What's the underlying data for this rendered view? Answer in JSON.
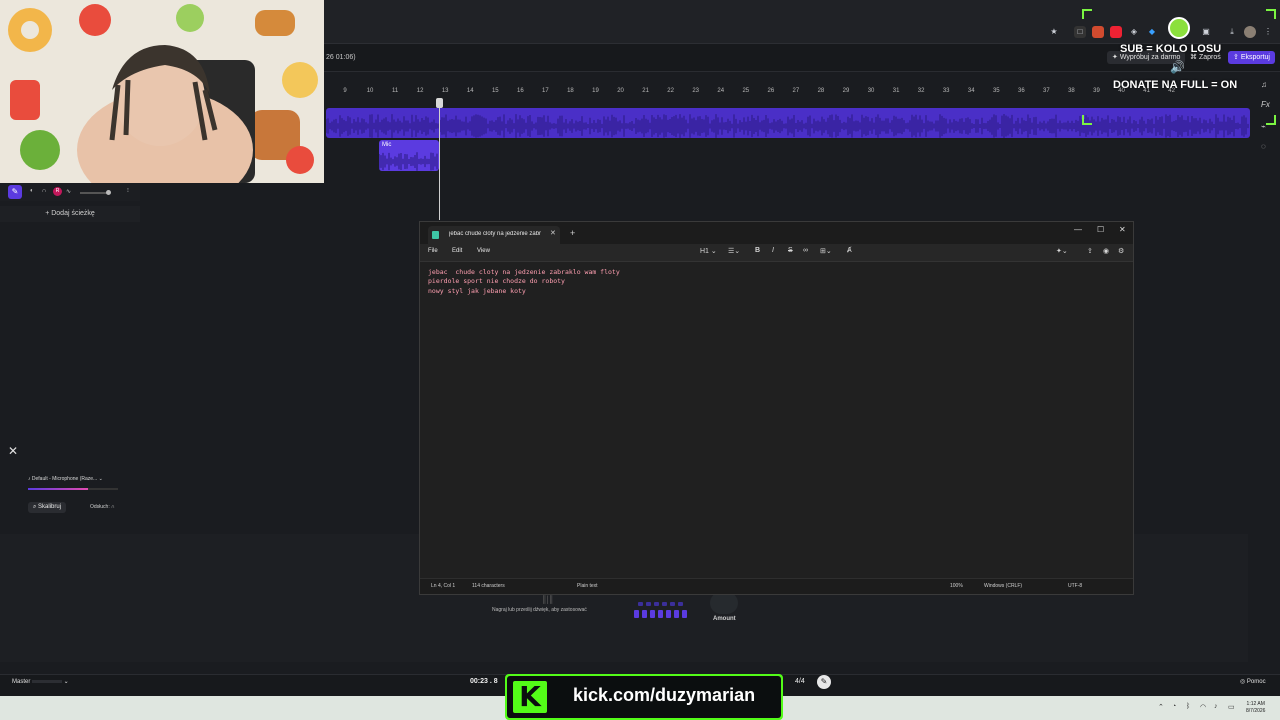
{
  "app": {
    "header_time": "26 01:06)",
    "try_free": "Wypróbuj za darmo",
    "invite": "Zaproś",
    "export": "Eksportuj"
  },
  "timeline": {
    "ticks": [
      "9",
      "10",
      "11",
      "12",
      "13",
      "14",
      "15",
      "16",
      "17",
      "18",
      "19",
      "20",
      "21",
      "22",
      "23",
      "24",
      "25",
      "26",
      "27",
      "28",
      "29",
      "30",
      "31",
      "32",
      "33",
      "34",
      "35",
      "36",
      "37",
      "38",
      "39",
      "40",
      "41",
      "42"
    ],
    "mic_clip_label": "Mic"
  },
  "left_panel": {
    "record_badge": "R",
    "add_track": "Dodaj ścieżkę"
  },
  "bottom_panel": {
    "mic_device": "Default - Microphone (Raze...",
    "calibrate": "Skalibruj",
    "monitor": "Odsłuch:",
    "record_hint": "Nagraj lub prześlij dźwięk, aby zastosować",
    "amount": "Amount"
  },
  "footer": {
    "master": "Master",
    "time": "00:23 . 8",
    "pages": "4/4",
    "help": "Pomoc"
  },
  "taskbar": {
    "time": "1:12 AM",
    "date": "8/7/2026"
  },
  "overlays": {
    "sub": "SUB = KOLO LOSU",
    "donate": "DONATE NA FULL = ON",
    "kick_url": "kick.com/duzymarian",
    "kick_logo": "K"
  },
  "notepad": {
    "tab_title": "jebac  chude cloty na jedzenie zabr",
    "menu": [
      "File",
      "Edit",
      "View"
    ],
    "heading_tool": "H1",
    "lines": "jebac  chude cloty na jedzenie zabraklo wam floty\npierdole sport nie chodze do roboty\nnowy styl jak jebane koty",
    "status": {
      "position": "Ln 4, Col 1",
      "chars": "114 characters",
      "format": "Plain text",
      "zoom": "100%",
      "line_ending": "Windows (CRLF)",
      "encoding": "UTF-8"
    }
  }
}
